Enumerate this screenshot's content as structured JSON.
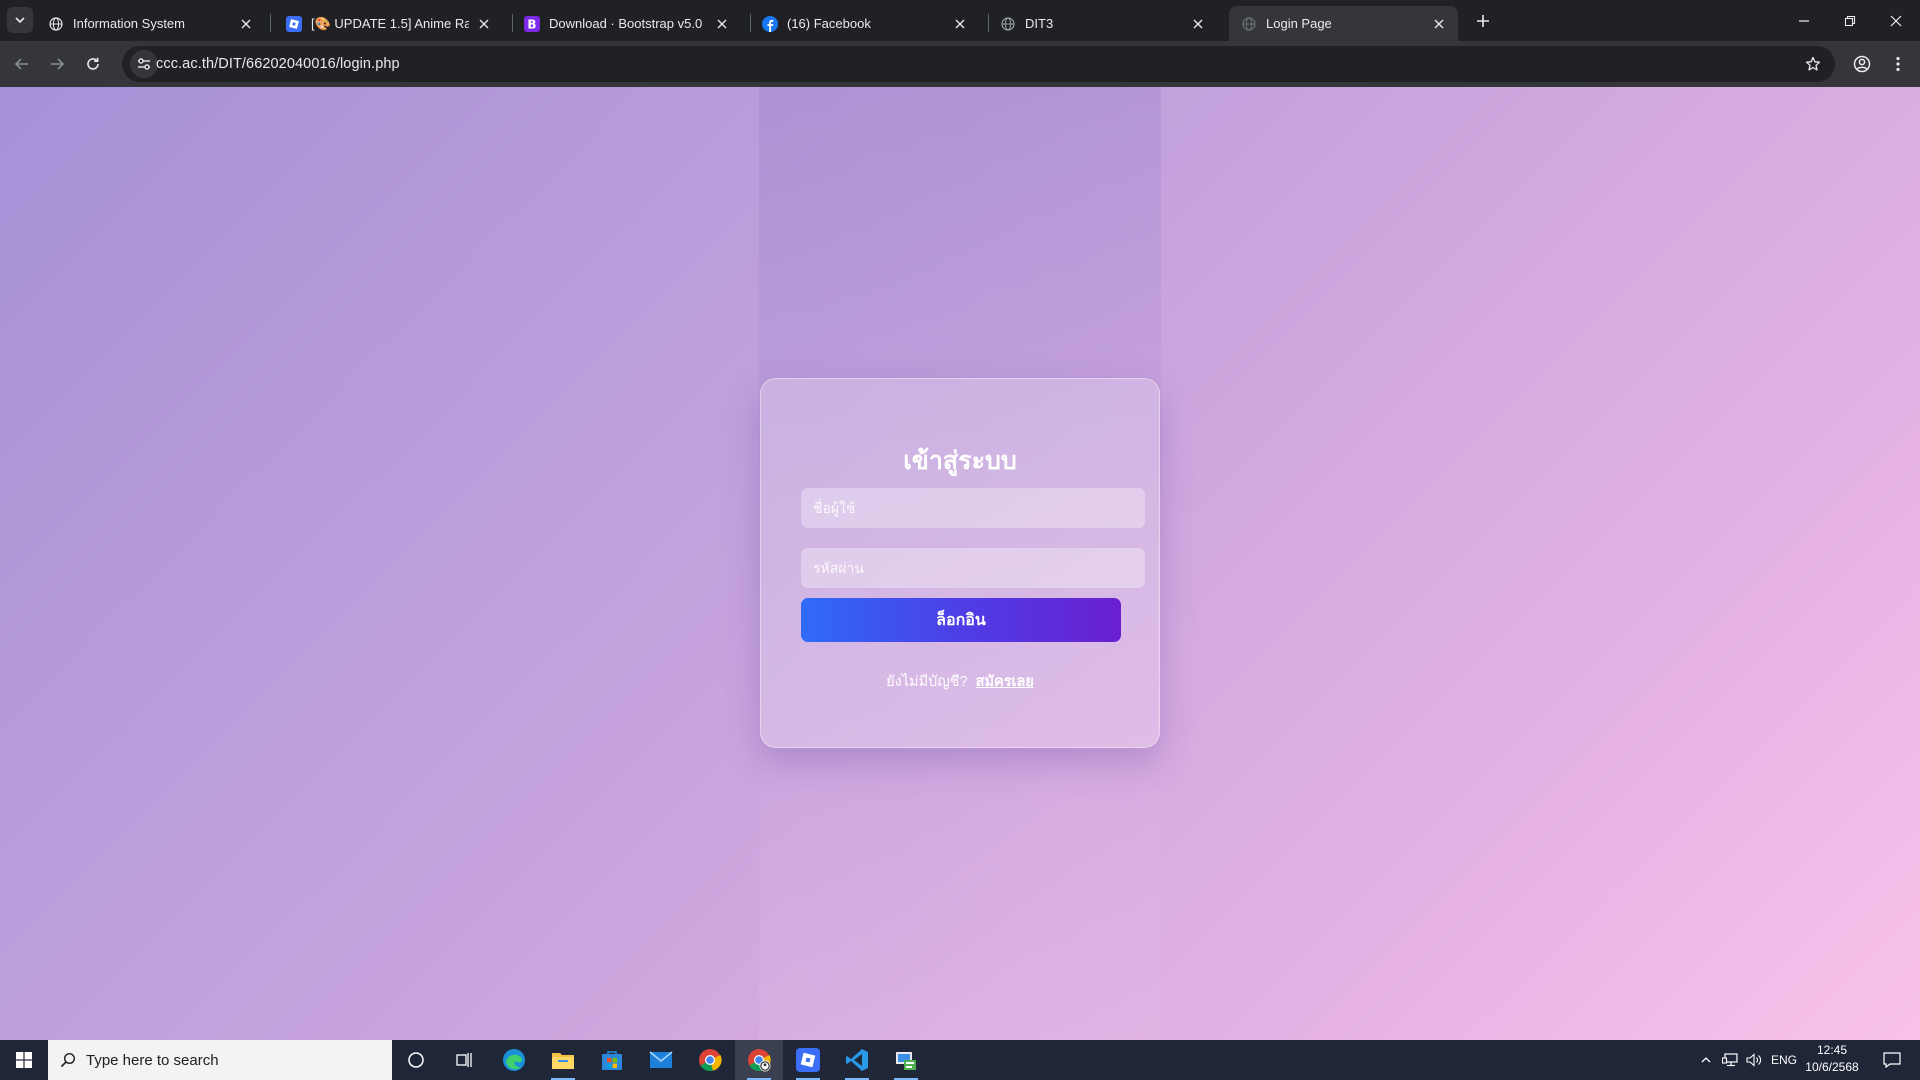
{
  "browser": {
    "tabs": [
      {
        "title": "Information System",
        "favicon": "globe-icon"
      },
      {
        "title": "[🎨 UPDATE 1.5] Anime Rangers X",
        "favicon": "roblox-icon"
      },
      {
        "title": "Download · Bootstrap v5.0",
        "favicon": "bootstrap-icon"
      },
      {
        "title": "(16) Facebook",
        "favicon": "facebook-icon"
      },
      {
        "title": "DIT3",
        "favicon": "globe-icon"
      },
      {
        "title": "Login Page",
        "favicon": "globe-icon",
        "active": true
      }
    ],
    "url": "ccc.ac.th/DIT/66202040016/login.php"
  },
  "login": {
    "title": "เข้าสู่ระบบ",
    "username_placeholder": "ชื่อผู้ใช้",
    "password_placeholder": "รหัสผ่าน",
    "button_label": "ล็อกอิน",
    "register_prompt": "ยังไม่มีบัญชี?",
    "register_link": "สมัครเลย",
    "colors": {
      "button_start": "#2f6bf6",
      "button_end": "#6a1fd0",
      "bg_start": "#a592d7",
      "bg_end": "#f8c2ea"
    }
  },
  "taskbar": {
    "search_placeholder": "Type here to search",
    "language": "ENG",
    "time": "12:45",
    "date": "10/6/2568",
    "apps": [
      "cortana-icon",
      "task-view-icon",
      "edge-icon",
      "file-explorer-icon",
      "store-icon",
      "mail-icon",
      "chrome-icon",
      "chrome-profile-icon",
      "roblox-icon",
      "vscode-icon",
      "app-icon"
    ]
  }
}
